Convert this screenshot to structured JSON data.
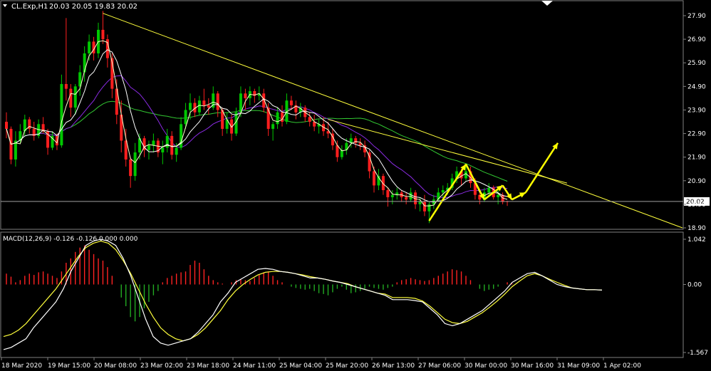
{
  "header": {
    "symbol": "CL.Exp,H1",
    "ohlc": "20.03 20.05 19.83 20.02"
  },
  "macd_label": "MACD(12,26,9) -0.126 -0.126 0.000 0.000",
  "price_ticks": [
    "27.90",
    "26.90",
    "25.90",
    "24.90",
    "23.90",
    "22.90",
    "21.90",
    "20.90",
    "19.90",
    "18.90"
  ],
  "current_price_label": "20.02",
  "macd_ticks": [
    "1.042",
    "0.00",
    "-1.567"
  ],
  "time_labels": [
    "18 Mar 2020",
    "19 Mar 15:00",
    "20 Mar 08:00",
    "23 Mar 02:00",
    "23 Mar 18:00",
    "24 Mar 11:00",
    "25 Mar 04:00",
    "25 Mar 20:00",
    "26 Mar 13:00",
    "27 Mar 06:00",
    "30 Mar 00:00",
    "30 Mar 16:00",
    "31 Mar 09:00",
    "1 Apr 02:00"
  ],
  "colors": {
    "background": "#000000",
    "bull": "#00c800",
    "bear": "#ff1e1e",
    "trendline": "#ffff3c",
    "ma_fast": "#ffffcc",
    "ma_mid": "#ffffff",
    "ma_slow": "#8a2be2",
    "ma_long": "#32c832",
    "macd_pos": "#ff2222",
    "macd_neg": "#22aa22",
    "macd_line": "#ffffff",
    "signal_line": "#ffff3c",
    "arrow": "#ffff00",
    "axis": "#808080"
  },
  "chart_data": {
    "type": "candlestick",
    "price_axis": {
      "min": 18.9,
      "max": 27.9,
      "ticks": [
        27.9,
        26.9,
        25.9,
        24.9,
        23.9,
        22.9,
        21.9,
        20.9,
        19.9,
        18.9
      ]
    },
    "current_price": 20.02,
    "macd_axis": {
      "min": -1.567,
      "max": 1.042
    },
    "candles": [
      [
        0,
        23.4,
        23.8,
        22.7,
        23.1
      ],
      [
        1,
        23.1,
        23.2,
        21.6,
        21.8
      ],
      [
        2,
        21.8,
        23.0,
        21.5,
        22.6
      ],
      [
        3,
        22.6,
        23.3,
        22.5,
        23.0
      ],
      [
        4,
        23.0,
        23.7,
        22.8,
        23.5
      ],
      [
        5,
        23.5,
        23.6,
        22.9,
        23.1
      ],
      [
        6,
        23.1,
        23.4,
        22.6,
        22.8
      ],
      [
        7,
        22.8,
        23.5,
        22.7,
        23.3
      ],
      [
        8,
        23.3,
        23.6,
        22.9,
        23.0
      ],
      [
        9,
        23.0,
        23.1,
        22.0,
        22.3
      ],
      [
        10,
        22.3,
        23.0,
        22.2,
        22.8
      ],
      [
        11,
        22.8,
        22.9,
        22.2,
        22.4
      ],
      [
        12,
        22.4,
        25.4,
        22.3,
        25.0
      ],
      [
        13,
        25.0,
        27.8,
        24.3,
        24.8
      ],
      [
        14,
        24.8,
        25.0,
        23.6,
        24.0
      ],
      [
        15,
        24.0,
        25.0,
        23.7,
        24.9
      ],
      [
        16,
        24.9,
        25.8,
        24.5,
        25.5
      ],
      [
        17,
        25.5,
        26.6,
        25.1,
        26.3
      ],
      [
        18,
        26.3,
        27.1,
        26.0,
        26.8
      ],
      [
        19,
        26.8,
        27.0,
        26.0,
        26.3
      ],
      [
        20,
        26.3,
        27.6,
        26.1,
        27.3
      ],
      [
        21,
        27.3,
        28.1,
        26.7,
        26.9
      ],
      [
        22,
        26.9,
        27.1,
        25.7,
        26.1
      ],
      [
        23,
        26.1,
        26.3,
        24.4,
        24.8
      ],
      [
        24,
        24.8,
        25.2,
        23.3,
        23.7
      ],
      [
        25,
        23.7,
        24.3,
        22.1,
        22.6
      ],
      [
        26,
        22.6,
        23.1,
        21.5,
        21.8
      ],
      [
        27,
        21.8,
        21.9,
        20.6,
        21.1
      ],
      [
        28,
        21.1,
        22.5,
        20.9,
        22.1
      ],
      [
        29,
        22.1,
        22.9,
        21.8,
        22.7
      ],
      [
        30,
        22.7,
        22.8,
        21.9,
        22.2
      ],
      [
        31,
        22.2,
        22.6,
        21.8,
        22.4
      ],
      [
        32,
        22.4,
        22.9,
        22.1,
        22.6
      ],
      [
        33,
        22.6,
        22.7,
        21.9,
        22.1
      ],
      [
        34,
        22.1,
        22.6,
        21.6,
        22.3
      ],
      [
        35,
        22.3,
        23.1,
        22.1,
        22.8
      ],
      [
        36,
        22.8,
        23.0,
        21.8,
        22.0
      ],
      [
        37,
        22.0,
        22.5,
        21.7,
        22.3
      ],
      [
        38,
        22.3,
        23.6,
        22.2,
        23.3
      ],
      [
        39,
        23.3,
        24.2,
        23.1,
        23.9
      ],
      [
        40,
        23.9,
        24.6,
        23.5,
        24.2
      ],
      [
        41,
        24.2,
        24.4,
        23.6,
        23.8
      ],
      [
        42,
        23.8,
        24.5,
        23.7,
        24.3
      ],
      [
        43,
        24.3,
        24.8,
        23.9,
        24.1
      ],
      [
        44,
        24.1,
        24.4,
        23.7,
        24.0
      ],
      [
        45,
        24.0,
        24.9,
        23.9,
        24.6
      ],
      [
        46,
        24.6,
        24.7,
        23.6,
        23.9
      ],
      [
        47,
        23.9,
        24.0,
        22.8,
        23.1
      ],
      [
        48,
        23.1,
        23.8,
        22.9,
        23.5
      ],
      [
        49,
        23.5,
        23.7,
        22.6,
        22.9
      ],
      [
        50,
        22.9,
        24.0,
        22.8,
        23.8
      ],
      [
        51,
        23.8,
        24.9,
        23.6,
        24.6
      ],
      [
        52,
        24.6,
        24.8,
        23.9,
        24.4
      ],
      [
        53,
        24.4,
        24.9,
        24.1,
        24.7
      ],
      [
        54,
        24.7,
        24.8,
        24.2,
        24.5
      ],
      [
        55,
        24.5,
        24.9,
        24.3,
        24.6
      ],
      [
        56,
        24.6,
        24.8,
        23.8,
        24.0
      ],
      [
        57,
        24.0,
        24.2,
        22.8,
        23.1
      ],
      [
        58,
        23.1,
        23.4,
        22.6,
        23.3
      ],
      [
        59,
        23.3,
        24.0,
        23.1,
        23.8
      ],
      [
        60,
        23.8,
        24.1,
        23.2,
        23.4
      ],
      [
        61,
        23.4,
        24.6,
        23.3,
        24.3
      ],
      [
        62,
        24.3,
        24.5,
        23.9,
        24.1
      ],
      [
        63,
        24.1,
        24.3,
        23.5,
        23.8
      ],
      [
        64,
        23.8,
        24.2,
        23.6,
        24.0
      ],
      [
        65,
        24.0,
        24.1,
        23.4,
        23.6
      ],
      [
        66,
        23.6,
        23.8,
        23.2,
        23.4
      ],
      [
        67,
        23.4,
        23.7,
        23.0,
        23.2
      ],
      [
        68,
        23.2,
        23.5,
        22.9,
        23.3
      ],
      [
        69,
        23.3,
        23.6,
        22.8,
        23.0
      ],
      [
        70,
        23.0,
        23.4,
        22.7,
        22.9
      ],
      [
        71,
        22.9,
        23.1,
        22.2,
        22.4
      ],
      [
        72,
        22.4,
        22.6,
        21.7,
        21.9
      ],
      [
        73,
        21.9,
        22.4,
        21.8,
        22.2
      ],
      [
        74,
        22.2,
        22.7,
        22.0,
        22.5
      ],
      [
        75,
        22.5,
        22.9,
        22.3,
        22.7
      ],
      [
        76,
        22.7,
        22.8,
        22.3,
        22.5
      ],
      [
        77,
        22.5,
        22.7,
        22.2,
        22.4
      ],
      [
        78,
        22.4,
        22.6,
        21.9,
        22.1
      ],
      [
        79,
        22.1,
        22.2,
        21.0,
        21.3
      ],
      [
        80,
        21.3,
        21.5,
        20.4,
        20.7
      ],
      [
        81,
        20.7,
        21.4,
        20.5,
        21.1
      ],
      [
        82,
        21.1,
        21.2,
        20.3,
        20.5
      ],
      [
        83,
        20.5,
        20.6,
        19.8,
        20.2
      ],
      [
        84,
        20.2,
        20.5,
        19.9,
        20.3
      ],
      [
        85,
        20.3,
        20.6,
        20.1,
        20.4
      ],
      [
        86,
        20.4,
        20.5,
        20.0,
        20.2
      ],
      [
        87,
        20.2,
        20.4,
        19.9,
        20.1
      ],
      [
        88,
        20.1,
        20.6,
        20.0,
        20.4
      ],
      [
        89,
        20.4,
        20.5,
        19.7,
        19.9
      ],
      [
        90,
        19.9,
        20.2,
        19.6,
        20.0
      ],
      [
        91,
        20.0,
        20.3,
        19.4,
        19.6
      ],
      [
        92,
        19.6,
        20.0,
        19.1,
        19.9
      ],
      [
        93,
        19.9,
        20.3,
        19.7,
        20.1
      ],
      [
        94,
        20.1,
        20.6,
        20.0,
        20.4
      ],
      [
        95,
        20.4,
        20.7,
        20.2,
        20.5
      ],
      [
        96,
        20.5,
        20.8,
        20.3,
        20.6
      ],
      [
        97,
        20.6,
        21.2,
        20.5,
        21.0
      ],
      [
        98,
        21.0,
        21.5,
        20.8,
        21.3
      ],
      [
        99,
        21.3,
        21.4,
        20.7,
        21.0
      ],
      [
        100,
        21.0,
        21.6,
        20.9,
        21.3
      ],
      [
        101,
        21.3,
        21.5,
        20.6,
        20.8
      ],
      [
        102,
        20.8,
        21.0,
        20.1,
        20.3
      ],
      [
        103,
        20.3,
        20.5,
        19.9,
        20.1
      ],
      [
        104,
        20.1,
        20.6,
        20.0,
        20.4
      ],
      [
        105,
        20.4,
        20.8,
        20.2,
        20.6
      ],
      [
        106,
        20.6,
        20.7,
        20.1,
        20.2
      ],
      [
        107,
        20.2,
        20.5,
        19.9,
        20.3
      ],
      [
        108,
        20.3,
        20.4,
        19.9,
        20.0
      ],
      [
        109,
        20.03,
        20.05,
        19.83,
        20.02
      ]
    ],
    "macd_hist": [
      0.25,
      0.18,
      0.05,
      0.1,
      0.2,
      0.25,
      0.22,
      0.28,
      0.3,
      0.25,
      0.2,
      0.15,
      0.3,
      0.5,
      0.6,
      0.75,
      0.85,
      0.9,
      0.8,
      0.7,
      0.6,
      0.55,
      0.4,
      0.2,
      0.0,
      -0.3,
      -0.5,
      -0.75,
      -0.85,
      -0.75,
      -0.55,
      -0.4,
      -0.25,
      -0.15,
      0.05,
      0.15,
      0.2,
      0.25,
      0.28,
      0.3,
      0.45,
      0.55,
      0.5,
      0.35,
      0.2,
      0.1,
      0.05,
      0.02,
      0.0,
      0.05,
      0.1,
      0.12,
      0.1,
      0.08,
      0.15,
      0.22,
      0.28,
      0.3,
      0.2,
      0.1,
      0.05,
      0.0,
      -0.05,
      -0.08,
      -0.1,
      -0.12,
      -0.1,
      -0.15,
      -0.2,
      -0.22,
      -0.25,
      -0.18,
      -0.1,
      -0.05,
      -0.12,
      -0.2,
      -0.18,
      -0.15,
      -0.1,
      -0.05,
      -0.08,
      -0.1,
      -0.12,
      -0.08,
      -0.05,
      0.05,
      0.1,
      0.12,
      0.15,
      0.12,
      0.1,
      0.08,
      0.1,
      0.15,
      0.2,
      0.25,
      0.3,
      0.35,
      0.33,
      0.3,
      0.2,
      0.1,
      0.0,
      -0.1,
      -0.15,
      -0.12,
      -0.1,
      -0.05,
      0.0,
      0.05,
      0.03,
      0.0
    ],
    "macd_line": [
      -1.5,
      -1.45,
      -1.35,
      -1.25,
      -1.0,
      -0.8,
      -0.6,
      -0.4,
      -0.1,
      0.3,
      0.6,
      0.9,
      1.0,
      1.04,
      1.0,
      0.9,
      0.6,
      0.2,
      -0.3,
      -0.8,
      -1.2,
      -1.35,
      -1.4,
      -1.35,
      -1.3,
      -1.25,
      -1.1,
      -0.9,
      -0.7,
      -0.4,
      -0.2,
      0.05,
      0.15,
      0.25,
      0.35,
      0.37,
      0.35,
      0.3,
      0.28,
      0.25,
      0.2,
      0.15,
      0.15,
      0.12,
      0.08,
      0.05,
      0.0,
      -0.05,
      -0.1,
      -0.15,
      -0.2,
      -0.25,
      -0.35,
      -0.35,
      -0.35,
      -0.37,
      -0.4,
      -0.55,
      -0.7,
      -0.9,
      -0.95,
      -0.9,
      -0.8,
      -0.7,
      -0.6,
      -0.45,
      -0.3,
      -0.15,
      0.05,
      0.15,
      0.25,
      0.28,
      0.2,
      0.1,
      0.0,
      -0.05,
      -0.08,
      -0.1,
      -0.12,
      -0.12,
      -0.13
    ],
    "signal_line": [
      -1.2,
      -1.15,
      -1.05,
      -0.9,
      -0.7,
      -0.5,
      -0.3,
      -0.1,
      0.15,
      0.4,
      0.65,
      0.85,
      0.95,
      1.0,
      0.95,
      0.8,
      0.55,
      0.25,
      -0.1,
      -0.45,
      -0.75,
      -1.0,
      -1.15,
      -1.25,
      -1.3,
      -1.25,
      -1.15,
      -1.0,
      -0.8,
      -0.6,
      -0.35,
      -0.15,
      0.0,
      0.12,
      0.22,
      0.28,
      0.3,
      0.3,
      0.28,
      0.25,
      0.22,
      0.18,
      0.15,
      0.12,
      0.08,
      0.05,
      0.02,
      -0.05,
      -0.1,
      -0.15,
      -0.2,
      -0.22,
      -0.3,
      -0.3,
      -0.3,
      -0.32,
      -0.38,
      -0.5,
      -0.65,
      -0.8,
      -0.88,
      -0.9,
      -0.85,
      -0.75,
      -0.65,
      -0.52,
      -0.38,
      -0.22,
      -0.05,
      0.08,
      0.2,
      0.25,
      0.2,
      0.12,
      0.05,
      -0.02,
      -0.08,
      -0.1,
      -0.12,
      -0.12,
      -0.13
    ],
    "trendlines": [
      {
        "from": [
          21,
          28.0
        ],
        "to": [
          152,
          18.9
        ]
      },
      {
        "from": [
          70,
          23.5
        ],
        "to": [
          122,
          20.8
        ]
      }
    ],
    "arrows_projection": [
      [
        92,
        19.2
      ],
      [
        100,
        21.6
      ],
      [
        104,
        20.1
      ],
      [
        108,
        20.7
      ],
      [
        110,
        20.1
      ],
      [
        113,
        20.4
      ],
      [
        120,
        22.5
      ]
    ]
  }
}
